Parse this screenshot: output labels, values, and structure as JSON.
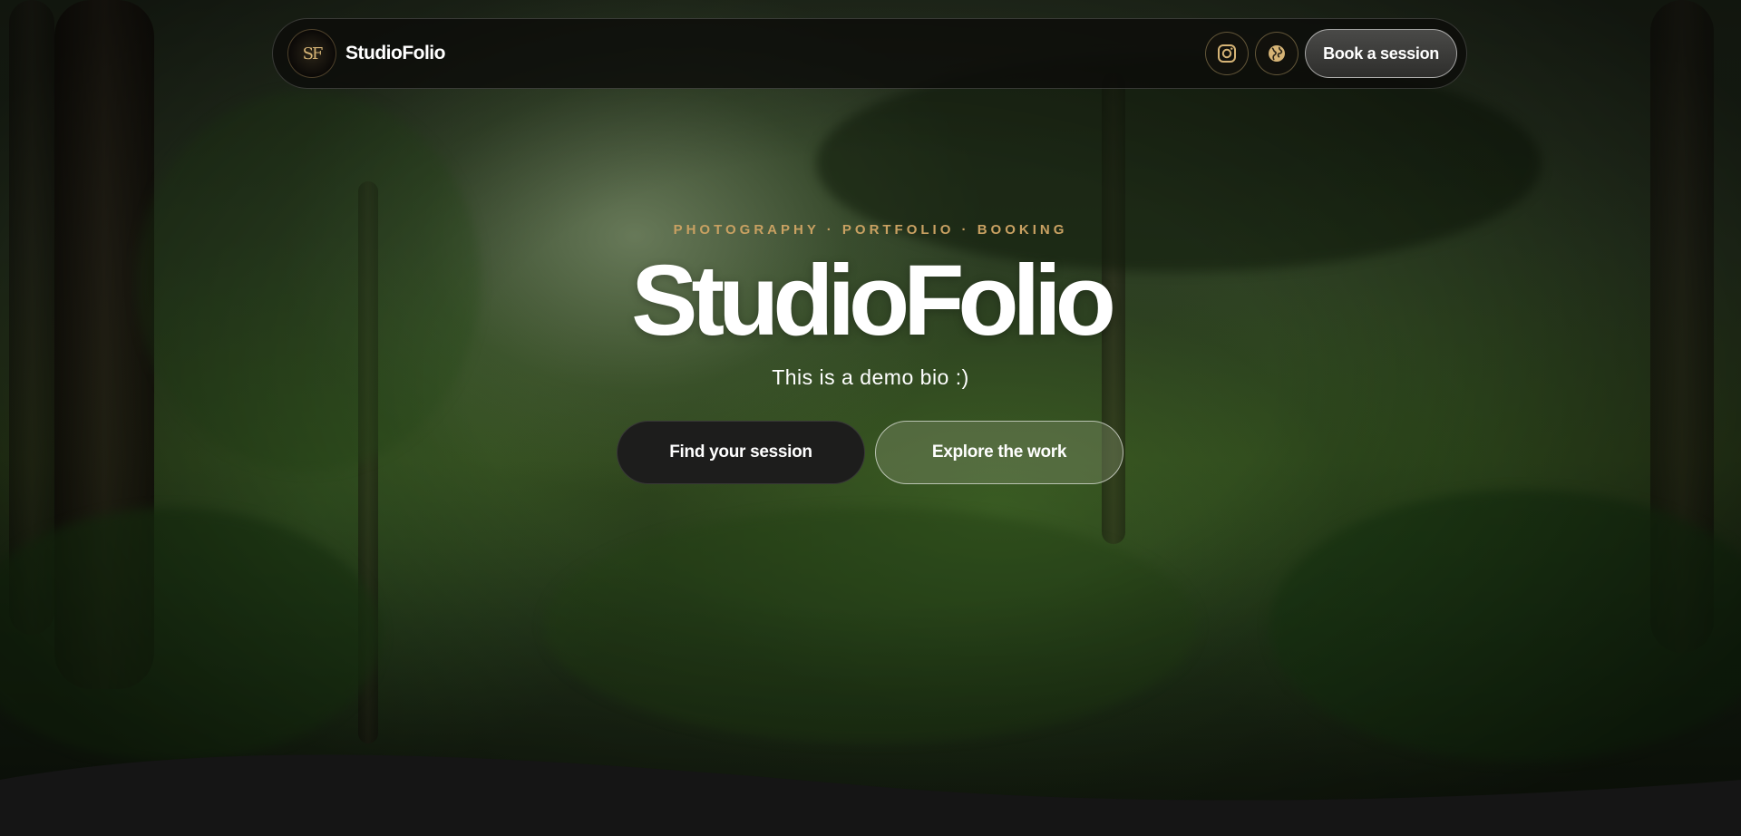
{
  "nav": {
    "logo_text": "SF",
    "brand": "StudioFolio",
    "instagram_icon": "instagram-icon",
    "globe_icon": "globe-icon",
    "book_label": "Book a session"
  },
  "hero": {
    "eyebrow": "PHOTOGRAPHY · PORTFOLIO · BOOKING",
    "title": "StudioFolio",
    "bio": "This is a demo bio :)",
    "primary_cta": "Find your session",
    "secondary_cta": "Explore the work"
  },
  "colors": {
    "accent_gold": "#c9a162",
    "footer_bg": "#151515",
    "primary_button_bg": "#1d1d1c"
  }
}
